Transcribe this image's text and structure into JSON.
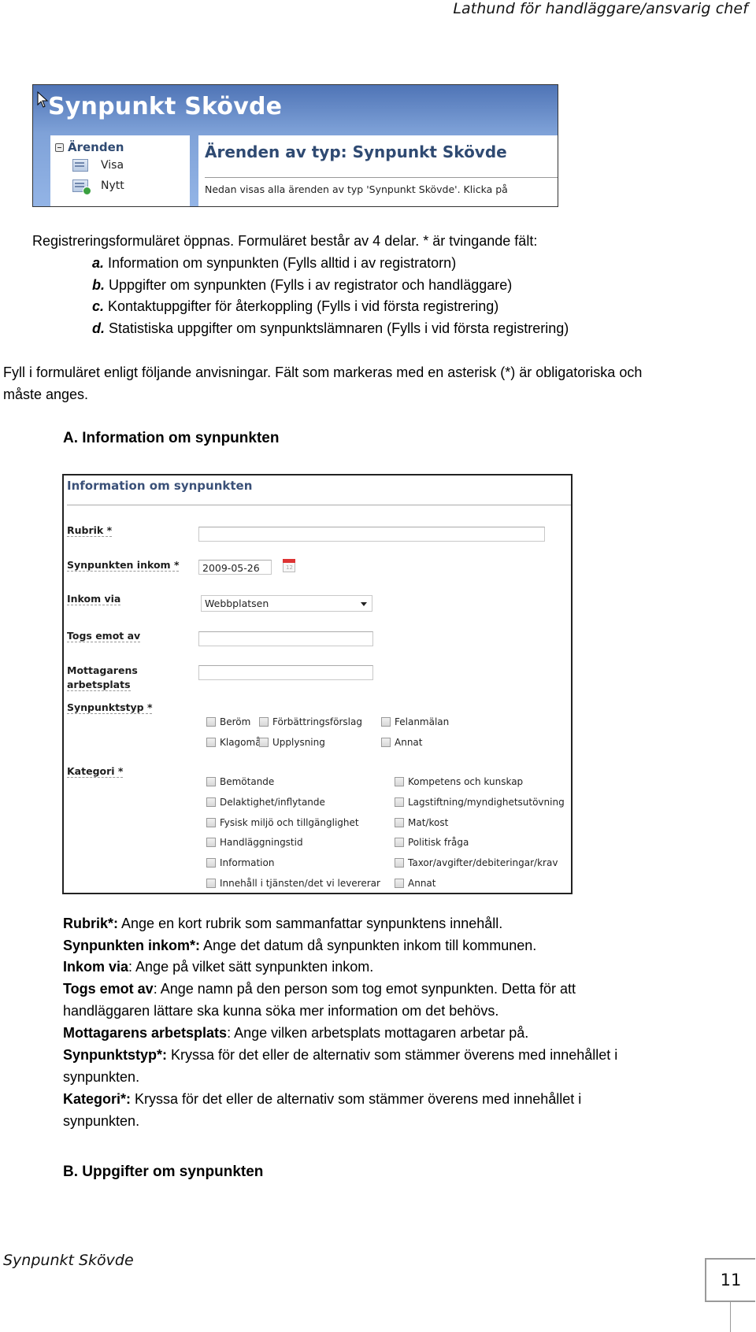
{
  "document": {
    "header": "Lathund för handläggare/ansvarig chef",
    "footer": "Synpunkt Skövde",
    "page_number": "11"
  },
  "screenshot_app": {
    "app_title": "Synpunkt Skövde",
    "sidebar": {
      "section": "Ärenden",
      "items": [
        {
          "label": "Visa",
          "icon": "list-icon"
        },
        {
          "label": "Nytt",
          "icon": "new-item-icon",
          "highlighted": true
        }
      ]
    },
    "main": {
      "heading": "Ärenden av typ: Synpunkt Skövde",
      "description": "Nedan visas alla ärenden av typ 'Synpunkt Skövde'. Klicka på"
    }
  },
  "intro": {
    "text": "Registreringsformuläret öppnas. Formuläret består av 4 delar. * är tvingande fält:",
    "parts": [
      {
        "letter": "a.",
        "text": " Information om synpunkten (Fylls alltid i av registratorn)"
      },
      {
        "letter": "b.",
        "text": " Uppgifter om synpunkten (Fylls i av registrator och handläggare)"
      },
      {
        "letter": "c.",
        "text": " Kontaktuppgifter för återkoppling (Fylls i vid första registrering)"
      },
      {
        "letter": "d.",
        "text": " Statistiska uppgifter om synpunktslämnaren (Fylls i vid första registrering)"
      }
    ],
    "instructions_line1": "Fyll i formuläret enligt följande anvisningar. Fält som markeras med en asterisk (*) är obligatoriska och",
    "instructions_line2": "måste anges."
  },
  "section_a": {
    "heading": "A. Information om synpunkten",
    "form": {
      "title": "Information om synpunkten",
      "rubrik": {
        "label": "Rubrik *",
        "value": ""
      },
      "inkom": {
        "label": "Synpunkten inkom *",
        "value": "2009-05-26"
      },
      "inkom_via": {
        "label": "Inkom via",
        "selected": "Webbplatsen"
      },
      "togs_emot": {
        "label": "Togs emot av",
        "value": ""
      },
      "mottagare": {
        "label_line1": "Mottagarens",
        "label_line2": "arbetsplats",
        "value": ""
      },
      "synpunktstyp": {
        "label": "Synpunktstyp *",
        "options": [
          "Beröm",
          "Förbättringsförslag",
          "Felanmälan",
          "Klagomål",
          "Upplysning",
          "Annat"
        ]
      },
      "kategori": {
        "label": "Kategori *",
        "left": [
          "Bemötande",
          "Delaktighet/inflytande",
          "Fysisk miljö och tillgänglighet",
          "Handläggningstid",
          "Information",
          "Innehåll i tjänsten/det vi levererar"
        ],
        "right": [
          "Kompetens och kunskap",
          "Lagstiftning/myndighetsutövning",
          "Mat/kost",
          "Politisk fråga",
          "Taxor/avgifter/debiteringar/krav",
          "Annat"
        ]
      }
    },
    "explanations": [
      {
        "term": "Rubrik*:",
        "text": " Ange en kort rubrik som sammanfattar synpunktens innehåll."
      },
      {
        "term": "Synpunkten inkom*:",
        "text": " Ange det datum då synpunkten inkom till kommunen."
      },
      {
        "term": "Inkom via",
        "text": ": Ange på vilket sätt synpunkten inkom."
      },
      {
        "term": "Togs emot av",
        "text": ": Ange namn på den person som tog emot synpunkten. Detta för att"
      },
      {
        "term": "",
        "text": "handläggaren lättare ska kunna söka mer information om det behövs."
      },
      {
        "term": "Mottagarens arbetsplats",
        "text": ": Ange vilken arbetsplats mottagaren arbetar på."
      },
      {
        "term": "Synpunktstyp*:",
        "text": " Kryssa för det eller de alternativ som stämmer överens med innehållet i"
      },
      {
        "term": "",
        "text": "synpunkten."
      },
      {
        "term": "Kategori*:",
        "text": " Kryssa för det eller de alternativ som stämmer överens med innehållet i"
      },
      {
        "term": "",
        "text": "synpunkten."
      }
    ]
  },
  "section_b": {
    "heading": "B. Uppgifter om synpunkten"
  }
}
